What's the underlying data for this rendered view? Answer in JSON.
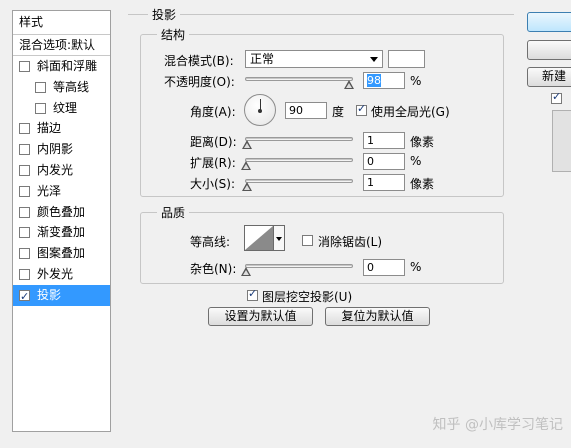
{
  "sidebar": {
    "header": "样式",
    "blend_options": "混合选项:默认",
    "items": [
      {
        "label": "斜面和浮雕",
        "checked": false,
        "indent": false,
        "selected": false
      },
      {
        "label": "等高线",
        "checked": false,
        "indent": true,
        "selected": false
      },
      {
        "label": "纹理",
        "checked": false,
        "indent": true,
        "selected": false
      },
      {
        "label": "描边",
        "checked": false,
        "indent": false,
        "selected": false
      },
      {
        "label": "内阴影",
        "checked": false,
        "indent": false,
        "selected": false
      },
      {
        "label": "内发光",
        "checked": false,
        "indent": false,
        "selected": false
      },
      {
        "label": "光泽",
        "checked": false,
        "indent": false,
        "selected": false
      },
      {
        "label": "颜色叠加",
        "checked": false,
        "indent": false,
        "selected": false
      },
      {
        "label": "渐变叠加",
        "checked": false,
        "indent": false,
        "selected": false
      },
      {
        "label": "图案叠加",
        "checked": false,
        "indent": false,
        "selected": false
      },
      {
        "label": "外发光",
        "checked": false,
        "indent": false,
        "selected": false
      },
      {
        "label": "投影",
        "checked": true,
        "indent": false,
        "selected": true
      }
    ]
  },
  "drop_shadow": {
    "title": "投影",
    "structure": {
      "title": "结构",
      "blend_mode_label": "混合模式(B):",
      "blend_mode_value": "正常",
      "shadow_color": "#ffffff",
      "opacity_label": "不透明度(O):",
      "opacity_value": "98",
      "opacity_unit": "%",
      "angle_label": "角度(A):",
      "angle_value": "90",
      "angle_unit": "度",
      "global_light_label": "使用全局光(G)",
      "global_light_checked": true,
      "distance_label": "距离(D):",
      "distance_value": "1",
      "distance_unit": "像素",
      "spread_label": "扩展(R):",
      "spread_value": "0",
      "spread_unit": "%",
      "size_label": "大小(S):",
      "size_value": "1",
      "size_unit": "像素"
    },
    "quality": {
      "title": "品质",
      "contour_label": "等高线:",
      "antialias_label": "消除锯齿(L)",
      "antialias_checked": false,
      "noise_label": "杂色(N):",
      "noise_value": "0",
      "noise_unit": "%"
    },
    "knockout_label": "图层挖空投影(U)",
    "knockout_checked": true,
    "make_default_label": "设置为默认值",
    "reset_default_label": "复位为默认值"
  },
  "right_panel": {
    "new_style_label": "新建"
  },
  "watermark": "知乎 @小库学习笔记"
}
